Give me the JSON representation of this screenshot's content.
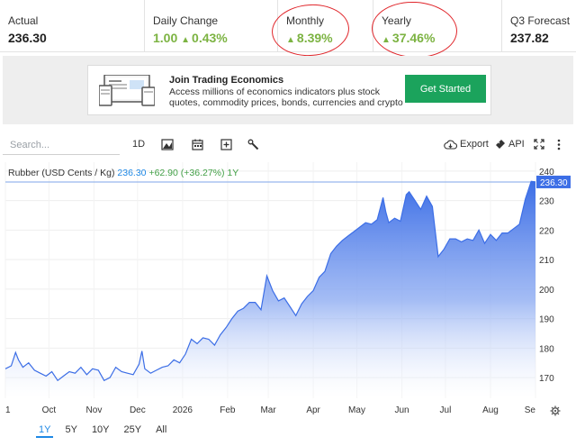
{
  "stats": [
    {
      "label": "Actual",
      "value": "236.30"
    },
    {
      "label": "Daily Change",
      "value_a": "1.00",
      "value_b": "0.43%"
    },
    {
      "label": "Monthly",
      "value": "8.39%"
    },
    {
      "label": "Yearly",
      "value": "37.46%"
    },
    {
      "label": "Q3 Forecast",
      "value": "237.82"
    }
  ],
  "promo": {
    "title": "Join Trading Economics",
    "text": "Access millions of economics indicators plus stock quotes, commodity prices, bonds, currencies and crypto",
    "button": "Get Started"
  },
  "toolbar": {
    "search_placeholder": "Search...",
    "interval": "1D",
    "export": "Export",
    "api": "API"
  },
  "ranges": [
    "1Y",
    "5Y",
    "10Y",
    "25Y",
    "All"
  ],
  "active_range": "1Y",
  "icons": [
    "chart-type-icon",
    "calendar-icon",
    "add-icon",
    "settings-wrench-icon",
    "cloud-download-icon",
    "api-icon",
    "fullscreen-icon",
    "more-icon",
    "gear-icon"
  ],
  "colors": {
    "accent": "#1e88e5",
    "green": "#7cb342",
    "button": "#1ba35c",
    "line": "#3c6ee6",
    "annotation": "#e0262b"
  },
  "chart_data": {
    "type": "area",
    "legend": {
      "name": "Rubber (USD Cents / Kg)",
      "last": "236.30",
      "change": "+62.90 (+36.27%)",
      "period": "1Y"
    },
    "last_label": "236.30",
    "ylim": [
      163,
      243
    ],
    "yticks": [
      170,
      180,
      190,
      200,
      210,
      220,
      230,
      240
    ],
    "xlim": [
      "2025-09-01",
      "2026-09-01"
    ],
    "xticks": [
      {
        "label": "1",
        "date": "2025-09-01"
      },
      {
        "label": "Oct",
        "date": "2025-10-01"
      },
      {
        "label": "Nov",
        "date": "2025-11-01"
      },
      {
        "label": "Dec",
        "date": "2025-12-01"
      },
      {
        "label": "2026",
        "date": "2026-01-01"
      },
      {
        "label": "Feb",
        "date": "2026-02-01"
      },
      {
        "label": "Mar",
        "date": "2026-03-01"
      },
      {
        "label": "Apr",
        "date": "2026-04-01"
      },
      {
        "label": "May",
        "date": "2026-05-01"
      },
      {
        "label": "Jun",
        "date": "2026-06-01"
      },
      {
        "label": "Jul",
        "date": "2026-07-01"
      },
      {
        "label": "Aug",
        "date": "2026-08-01"
      },
      {
        "label": "Se",
        "date": "2026-09-01"
      }
    ],
    "x": [
      "2025-09-01",
      "2025-09-05",
      "2025-09-08",
      "2025-09-10",
      "2025-09-13",
      "2025-09-17",
      "2025-09-21",
      "2025-09-25",
      "2025-09-29",
      "2025-10-03",
      "2025-10-07",
      "2025-10-11",
      "2025-10-15",
      "2025-10-19",
      "2025-10-23",
      "2025-10-27",
      "2025-10-31",
      "2025-11-04",
      "2025-11-08",
      "2025-11-12",
      "2025-11-16",
      "2025-11-20",
      "2025-11-24",
      "2025-11-28",
      "2025-12-02",
      "2025-12-04",
      "2025-12-06",
      "2025-12-10",
      "2025-12-14",
      "2025-12-18",
      "2025-12-22",
      "2025-12-26",
      "2025-12-30",
      "2026-01-03",
      "2026-01-07",
      "2026-01-11",
      "2026-01-15",
      "2026-01-19",
      "2026-01-23",
      "2026-01-27",
      "2026-01-31",
      "2026-02-04",
      "2026-02-08",
      "2026-02-12",
      "2026-02-16",
      "2026-02-20",
      "2026-02-24",
      "2026-02-28",
      "2026-03-04",
      "2026-03-08",
      "2026-03-12",
      "2026-03-16",
      "2026-03-20",
      "2026-03-24",
      "2026-03-28",
      "2026-04-01",
      "2026-04-05",
      "2026-04-09",
      "2026-04-13",
      "2026-04-17",
      "2026-04-21",
      "2026-04-25",
      "2026-04-29",
      "2026-05-03",
      "2026-05-07",
      "2026-05-11",
      "2026-05-15",
      "2026-05-19",
      "2026-05-21",
      "2026-05-23",
      "2026-05-27",
      "2026-05-31",
      "2026-06-04",
      "2026-06-06",
      "2026-06-10",
      "2026-06-14",
      "2026-06-18",
      "2026-06-22",
      "2026-06-26",
      "2026-06-30",
      "2026-07-04",
      "2026-07-08",
      "2026-07-12",
      "2026-07-16",
      "2026-07-20",
      "2026-07-24",
      "2026-07-28",
      "2026-08-01",
      "2026-08-05",
      "2026-08-09",
      "2026-08-13",
      "2026-08-17",
      "2026-08-21",
      "2026-08-25",
      "2026-08-29",
      "2026-09-01"
    ],
    "values": [
      173.0,
      174.0,
      178.5,
      176.0,
      173.5,
      175.0,
      172.5,
      171.5,
      170.5,
      172.0,
      169.0,
      170.5,
      172.0,
      171.5,
      173.5,
      171.0,
      173.0,
      172.5,
      169.0,
      170.0,
      173.5,
      172.0,
      171.5,
      171.0,
      174.5,
      179.0,
      173.0,
      171.5,
      172.5,
      173.5,
      174.0,
      176.0,
      175.0,
      178.0,
      183.0,
      181.5,
      183.5,
      183.0,
      181.0,
      184.5,
      187.0,
      190.0,
      192.5,
      193.5,
      195.5,
      195.5,
      193.0,
      204.5,
      199.5,
      196.0,
      197.0,
      194.0,
      191.0,
      195.0,
      197.5,
      199.5,
      204.0,
      206.0,
      212.0,
      214.5,
      216.5,
      218.0,
      219.5,
      221.0,
      222.5,
      222.0,
      223.5,
      231.0,
      226.0,
      222.5,
      224.0,
      223.0,
      232.0,
      233.0,
      230.0,
      227.0,
      231.5,
      228.0,
      211.0,
      213.5,
      217.0,
      217.0,
      216.0,
      217.0,
      216.5,
      220.0,
      215.5,
      218.5,
      216.5,
      219.0,
      219.0,
      220.5,
      222.0,
      230.5,
      236.5,
      236.3
    ]
  }
}
